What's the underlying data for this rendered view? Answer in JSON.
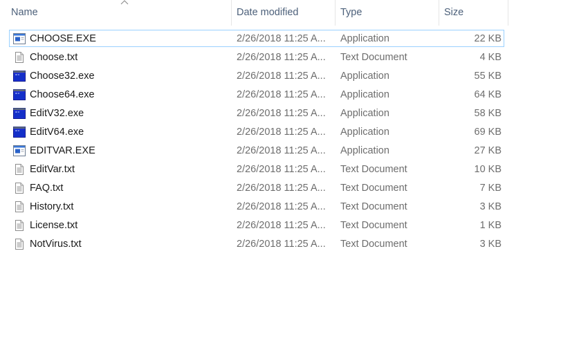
{
  "columns": {
    "name": "Name",
    "date_modified": "Date modified",
    "type": "Type",
    "size": "Size"
  },
  "sort": {
    "column": "name",
    "direction": "ascending",
    "icon": "chevron-up-icon"
  },
  "files": [
    {
      "name": "CHOOSE.EXE",
      "date": "2/26/2018 11:25 A...",
      "type": "Application",
      "size": "22 KB",
      "icon": "dos-app-icon",
      "focused": true
    },
    {
      "name": "Choose.txt",
      "date": "2/26/2018 11:25 A...",
      "type": "Text Document",
      "size": "4 KB",
      "icon": "text-file-icon"
    },
    {
      "name": "Choose32.exe",
      "date": "2/26/2018 11:25 A...",
      "type": "Application",
      "size": "55 KB",
      "icon": "console-app-icon"
    },
    {
      "name": "Choose64.exe",
      "date": "2/26/2018 11:25 A...",
      "type": "Application",
      "size": "64 KB",
      "icon": "console-app-icon"
    },
    {
      "name": "EditV32.exe",
      "date": "2/26/2018 11:25 A...",
      "type": "Application",
      "size": "58 KB",
      "icon": "console-app-icon"
    },
    {
      "name": "EditV64.exe",
      "date": "2/26/2018 11:25 A...",
      "type": "Application",
      "size": "69 KB",
      "icon": "console-app-icon"
    },
    {
      "name": "EDITVAR.EXE",
      "date": "2/26/2018 11:25 A...",
      "type": "Application",
      "size": "27 KB",
      "icon": "dos-app-icon"
    },
    {
      "name": "EditVar.txt",
      "date": "2/26/2018 11:25 A...",
      "type": "Text Document",
      "size": "10 KB",
      "icon": "text-file-icon"
    },
    {
      "name": "FAQ.txt",
      "date": "2/26/2018 11:25 A...",
      "type": "Text Document",
      "size": "7 KB",
      "icon": "text-file-icon"
    },
    {
      "name": "History.txt",
      "date": "2/26/2018 11:25 A...",
      "type": "Text Document",
      "size": "3 KB",
      "icon": "text-file-icon"
    },
    {
      "name": "License.txt",
      "date": "2/26/2018 11:25 A...",
      "type": "Text Document",
      "size": "1 KB",
      "icon": "text-file-icon"
    },
    {
      "name": "NotVirus.txt",
      "date": "2/26/2018 11:25 A...",
      "type": "Text Document",
      "size": "3 KB",
      "icon": "text-file-icon"
    }
  ],
  "colors": {
    "header_text": "#4c607a",
    "focus_border": "#99d1ff",
    "detail_text": "#6d6d6d",
    "console_blue": "#1f2fd6"
  }
}
